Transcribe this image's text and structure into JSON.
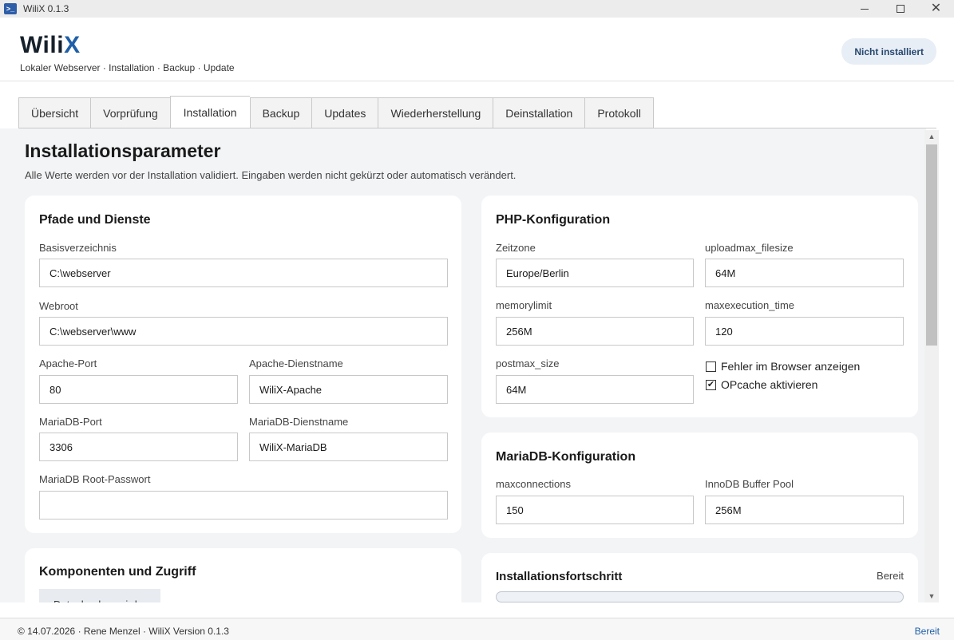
{
  "window": {
    "title": "WiliX 0.1.3"
  },
  "header": {
    "brand_main": "Wili",
    "brand_accent": "X",
    "tagline": "Lokaler Webserver · Installation · Backup · Update",
    "status": "Nicht installiert"
  },
  "tabs": [
    {
      "label": "Übersicht"
    },
    {
      "label": "Vorprüfung"
    },
    {
      "label": "Installation",
      "active": true
    },
    {
      "label": "Backup"
    },
    {
      "label": "Updates"
    },
    {
      "label": "Wiederherstellung"
    },
    {
      "label": "Deinstallation"
    },
    {
      "label": "Protokoll"
    }
  ],
  "page": {
    "title": "Installationsparameter",
    "subtitle": "Alle Werte werden vor der Installation validiert. Eingaben werden nicht gekürzt oder automatisch verändert."
  },
  "paths": {
    "title": "Pfade und Dienste",
    "basedir_label": "Basisverzeichnis",
    "basedir_value": "C:\\webserver",
    "webroot_label": "Webroot",
    "webroot_value": "C:\\webserver\\www",
    "apache_port_label": "Apache-Port",
    "apache_port_value": "80",
    "apache_service_label": "Apache-Dienstname",
    "apache_service_value": "WiliX-Apache",
    "mariadb_port_label": "MariaDB-Port",
    "mariadb_port_value": "3306",
    "mariadb_service_label": "MariaDB-Dienstname",
    "mariadb_service_value": "WiliX-MariaDB",
    "root_pw_label": "MariaDB Root-Passwort",
    "root_pw_value": ""
  },
  "php": {
    "title": "PHP-Konfiguration",
    "timezone_label": "Zeitzone",
    "timezone_value": "Europe/Berlin",
    "upload_label": "uploadmax_filesize",
    "upload_value": "64M",
    "memory_label": "memorylimit",
    "memory_value": "256M",
    "exec_label": "maxexecution_time",
    "exec_value": "120",
    "post_label": "postmax_size",
    "post_value": "64M",
    "show_errors_label": "Fehler im Browser anzeigen",
    "show_errors_checked": false,
    "opcache_label": "OPcache aktivieren",
    "opcache_checked": true
  },
  "mariadb": {
    "title": "MariaDB-Konfiguration",
    "maxconn_label": "maxconnections",
    "maxconn_value": "150",
    "buffer_label": "InnoDB Buffer Pool",
    "buffer_value": "256M"
  },
  "progress": {
    "title": "Installationsfortschritt",
    "status": "Bereit",
    "value": 0
  },
  "components": {
    "title": "Komponenten und Zugriff",
    "button_label": "Datenbanken wird..."
  },
  "footer": {
    "left": "© 14.07.2026 · Rene Menzel · WiliX Version 0.1.3",
    "right": "Bereit"
  }
}
